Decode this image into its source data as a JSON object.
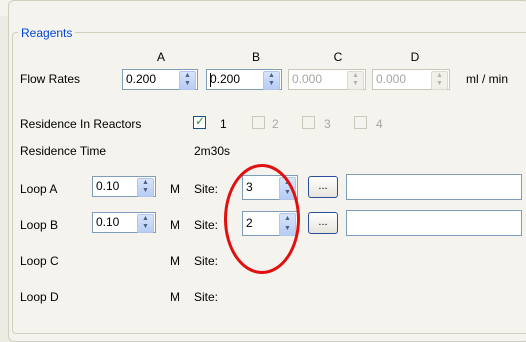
{
  "group_title": "Reagents",
  "columns": [
    "A",
    "B",
    "C",
    "D"
  ],
  "flow_rates": {
    "label": "Flow Rates",
    "values": [
      "0.200",
      "0.200",
      "0.000",
      "0.000"
    ],
    "unit": "ml / min"
  },
  "residence_in_reactors": {
    "label": "Residence In Reactors",
    "options": [
      {
        "label": "1",
        "checked": true
      },
      {
        "label": "2",
        "checked": false
      },
      {
        "label": "3",
        "checked": false
      },
      {
        "label": "4",
        "checked": false
      }
    ]
  },
  "residence_time": {
    "label": "Residence Time",
    "value": "2m30s"
  },
  "loops": [
    {
      "label": "Loop A",
      "value": "0.10",
      "unit": "M",
      "site_label": "Site:",
      "site_value": "3",
      "browse_label": "..."
    },
    {
      "label": "Loop B",
      "value": "0.10",
      "unit": "M",
      "site_label": "Site:",
      "site_value": "2",
      "browse_label": "..."
    },
    {
      "label": "Loop C",
      "unit": "M",
      "site_label": "Site:"
    },
    {
      "label": "Loop D",
      "unit": "M",
      "site_label": "Site:"
    }
  ],
  "colors": {
    "accent": "#0046d5",
    "annotation_circle": "#e01010"
  }
}
